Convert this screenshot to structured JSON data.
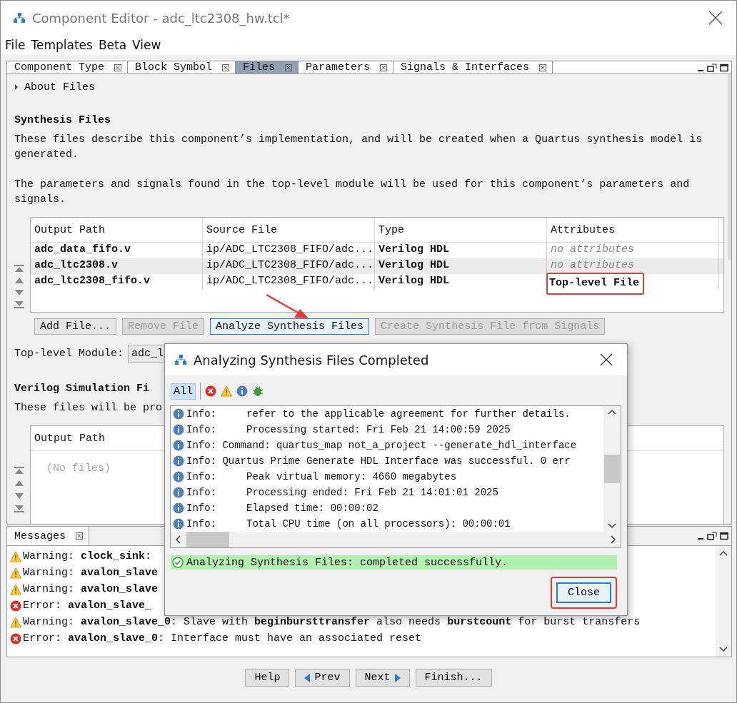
{
  "window": {
    "title": "Component Editor - adc_ltc2308_hw.tcl*"
  },
  "menu": [
    "File",
    "Templates",
    "Beta",
    "View"
  ],
  "tabs": [
    {
      "label": "Component Type",
      "selected": false
    },
    {
      "label": "Block Symbol",
      "selected": false
    },
    {
      "label": "Files",
      "selected": true
    },
    {
      "label": "Parameters",
      "selected": false
    },
    {
      "label": "Signals & Interfaces",
      "selected": false
    }
  ],
  "about": {
    "label": "About Files",
    "expanded": false
  },
  "synthesis": {
    "heading": "Synthesis Files",
    "paragraphs": [
      "These files describe this component’s implementation, and will be created when a Quartus synthesis model is generated.",
      "The parameters and signals found in the top-level module will be used for this component’s parameters and signals."
    ],
    "table": {
      "columns": [
        "Output Path",
        "Source File",
        "Type",
        "Attributes"
      ],
      "rows": [
        {
          "output_path": "adc_data_fifo.v",
          "source_file": "ip/ADC_LTC2308_FIFO/adc...",
          "type": "Verilog HDL",
          "attributes": "no attributes",
          "kind": "none",
          "highlighted": false
        },
        {
          "output_path": "adc_ltc2308.v",
          "source_file": "ip/ADC_LTC2308_FIFO/adc...",
          "type": "Verilog HDL",
          "attributes": "no attributes",
          "kind": "none",
          "highlighted": false
        },
        {
          "output_path": "adc_ltc2308_fifo.v",
          "source_file": "ip/ADC_LTC2308_FIFO/adc...",
          "type": "Verilog HDL",
          "attributes": "Top-level File",
          "kind": "top",
          "highlighted": true
        }
      ]
    },
    "buttons": [
      {
        "label": "Add File...",
        "disabled": false,
        "focused": false
      },
      {
        "label": "Remove File",
        "disabled": true,
        "focused": false
      },
      {
        "label": "Analyze Synthesis Files",
        "disabled": false,
        "focused": true
      },
      {
        "label": "Create Synthesis File from Signals",
        "disabled": true,
        "focused": false
      }
    ],
    "top_level_module": {
      "label": "Top-level Module:",
      "value": "adc_l"
    }
  },
  "simulation": {
    "heading": "Verilog Simulation Fi",
    "description": "These files will be pro",
    "table": {
      "columns": [
        "Output Path"
      ],
      "empty_text": "(No files)"
    }
  },
  "messages": {
    "tab": "Messages",
    "items": [
      {
        "kind": "warning",
        "text": "Warning: **clock_sink**:"
      },
      {
        "kind": "warning",
        "text": "Warning: **avalon_slave**"
      },
      {
        "kind": "warning",
        "text": "Warning: **avalon_slave**"
      },
      {
        "kind": "error",
        "text": "Error: **avalon_slave_**"
      },
      {
        "kind": "warning",
        "text": "Warning: **avalon_slave_0**: Slave with **beginbursttransfer** also needs **burstcount** for burst transfers"
      },
      {
        "kind": "error",
        "text": "Error: **avalon_slave_0**: Interface must have an associated reset"
      }
    ]
  },
  "footer_buttons": [
    {
      "label": "Help",
      "kind": "plain"
    },
    {
      "label": "Prev",
      "kind": "prev"
    },
    {
      "label": "Next",
      "kind": "next"
    },
    {
      "label": "Finish...",
      "kind": "plain"
    }
  ],
  "dialog": {
    "title": "Analyzing Synthesis Files Completed",
    "filters": [
      {
        "kind": "all",
        "label": "All",
        "selected": true
      },
      {
        "kind": "error",
        "selected": false
      },
      {
        "kind": "warning",
        "selected": false
      },
      {
        "kind": "info",
        "selected": false
      },
      {
        "kind": "debug",
        "selected": false
      }
    ],
    "log": [
      "Info:     refer to the applicable agreement for further details.",
      "Info:     Processing started: Fri Feb 21 14:00:59 2025",
      "Info: Command: quartus_map not_a_project --generate_hdl_interface",
      "Info: Quartus Prime Generate HDL Interface was successful. 0 err",
      "Info:     Peak virtual memory: 4660 megabytes",
      "Info:     Processing ended: Fri Feb 21 14:01:01 2025",
      "Info:     Elapsed time: 00:00:02",
      "Info:     Total CPU time (on all processors): 00:00:01"
    ],
    "status": "Analyzing Synthesis Files: completed successfully.",
    "button": {
      "label": "Close",
      "highlighted": true
    }
  }
}
